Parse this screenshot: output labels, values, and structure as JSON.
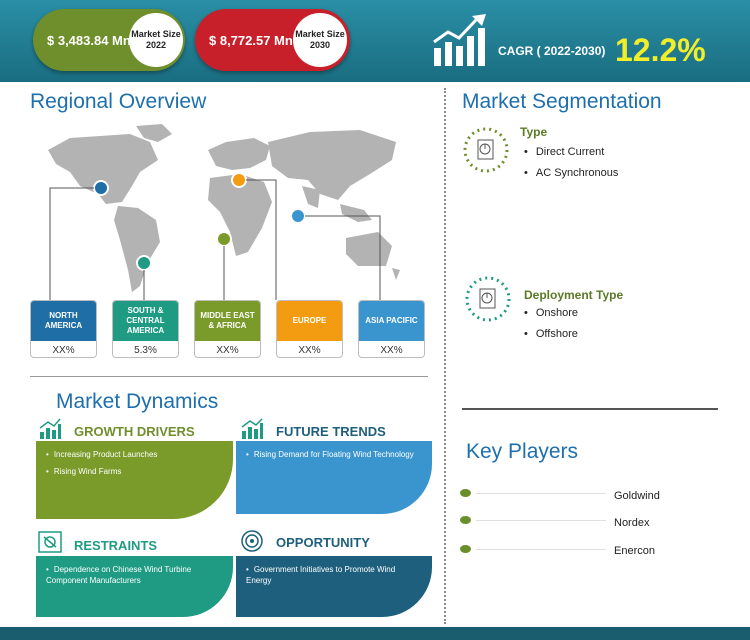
{
  "header": {
    "market_2022": {
      "value": "$ 3,483.84 Mn",
      "label": "Market Size 2022",
      "color": "#6f8f2c"
    },
    "market_2030": {
      "value": "$ 8,772.57 Mn",
      "label": "Market Size 2030",
      "color": "#c8202a"
    },
    "cagr_label": "CAGR ( 2022-2030)",
    "cagr_value": "12.2%"
  },
  "regional": {
    "title": "Regional Overview",
    "regions": [
      {
        "name": "NORTH AMERICA",
        "value": "XX%",
        "color": "#1f6fa6"
      },
      {
        "name": "SOUTH & CENTRAL AMERICA",
        "value": "5.3%",
        "color": "#1f9b84"
      },
      {
        "name": "MIDDLE EAST & AFRICA",
        "value": "XX%",
        "color": "#7a9a2a"
      },
      {
        "name": "EUROPE",
        "value": "XX%",
        "color": "#f39c12"
      },
      {
        "name": "ASIA PACIFIC",
        "value": "XX%",
        "color": "#3a95cf"
      }
    ]
  },
  "segmentation": {
    "title": "Market Segmentation",
    "groups": [
      {
        "heading": "Type",
        "items": [
          "Direct Current",
          "AC Synchronous"
        ]
      },
      {
        "heading": "Deployment Type",
        "items": [
          "Onshore",
          "Offshore"
        ]
      }
    ]
  },
  "dynamics": {
    "title": "Market Dynamics",
    "growth": {
      "heading": "GROWTH DRIVERS",
      "items": [
        "Increasing Product Launches",
        "Rising Wind Farms"
      ],
      "color": "#7a9a2a"
    },
    "trends": {
      "heading": "FUTURE TRENDS",
      "items": [
        "Rising Demand for Floating Wind Technology"
      ],
      "color": "#3a95cf"
    },
    "restraints": {
      "heading": "RESTRAINTS",
      "items": [
        "Dependence on Chinese Wind Turbine Component Manufacturers"
      ],
      "color": "#1f9b84"
    },
    "opportunity": {
      "heading": "OPPORTUNITY",
      "items": [
        "Government Initiatives to Promote Wind Energy"
      ],
      "color": "#1e5f7d"
    }
  },
  "key_players": {
    "title": "Key Players",
    "players": [
      "Goldwind",
      "Nordex",
      "Enercon"
    ]
  }
}
